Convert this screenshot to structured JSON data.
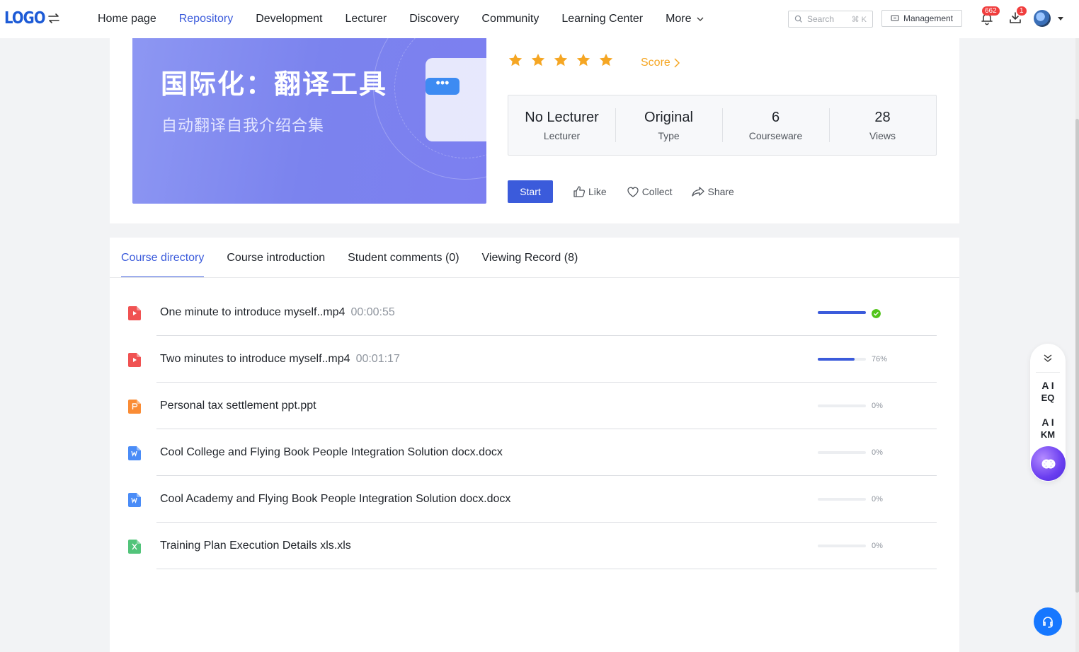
{
  "nav": {
    "logo": "LOGO",
    "items": [
      {
        "label": "Home page",
        "active": false
      },
      {
        "label": "Repository",
        "active": true
      },
      {
        "label": "Development",
        "active": false
      },
      {
        "label": "Lecturer",
        "active": false
      },
      {
        "label": "Discovery",
        "active": false
      },
      {
        "label": "Community",
        "active": false
      },
      {
        "label": "Learning Center",
        "active": false
      }
    ],
    "more_label": "More",
    "search_placeholder": "Search",
    "search_shortcut": "⌘ K",
    "management_label": "Management",
    "notification_count": "662",
    "download_count": "1"
  },
  "course": {
    "cover_title": "国际化：翻译工具",
    "cover_subtitle": "自动翻译自我介绍合集",
    "rating": 5,
    "score_label": "Score",
    "stats": [
      {
        "value": "No Lecturer",
        "label": "Lecturer"
      },
      {
        "value": "Original",
        "label": "Type"
      },
      {
        "value": "6",
        "label": "Courseware"
      },
      {
        "value": "28",
        "label": "Views"
      }
    ],
    "actions": {
      "start": "Start",
      "like": "Like",
      "collect": "Collect",
      "share": "Share"
    }
  },
  "tabs": [
    {
      "label": "Course directory",
      "active": true
    },
    {
      "label": "Course introduction",
      "active": false
    },
    {
      "label": "Student comments (0)",
      "active": false
    },
    {
      "label": "Viewing Record (8)",
      "active": false
    }
  ],
  "files": [
    {
      "name": "One minute to introduce myself..mp4",
      "duration": "00:00:55",
      "type": "video",
      "progress": 1.0,
      "progress_text": "",
      "completed": true
    },
    {
      "name": "Two minutes to introduce myself..mp4",
      "duration": "00:01:17",
      "type": "video",
      "progress": 0.76,
      "progress_text": "76%",
      "completed": false
    },
    {
      "name": "Personal tax settlement ppt.ppt",
      "duration": "",
      "type": "ppt",
      "progress": 0,
      "progress_text": "0%",
      "completed": false
    },
    {
      "name": "Cool College and Flying Book People Integration Solution docx.docx",
      "duration": "",
      "type": "doc",
      "progress": 0,
      "progress_text": "0%",
      "completed": false
    },
    {
      "name": "Cool Academy and Flying Book People Integration Solution docx.docx",
      "duration": "",
      "type": "doc",
      "progress": 0,
      "progress_text": "0%",
      "completed": false
    },
    {
      "name": "Training Plan Execution Details xls.xls",
      "duration": "",
      "type": "xls",
      "progress": 0,
      "progress_text": "0%",
      "completed": false
    }
  ],
  "float_panel": {
    "ai_eq_top": "A I",
    "ai_eq_bottom": "EQ",
    "ai_km_top": "A I",
    "ai_km_bottom": "KM"
  },
  "colors": {
    "accent": "#3b5bdb",
    "star": "#f5a623",
    "video": "#f05252",
    "ppt": "#fa8c35",
    "doc": "#4a8cf7",
    "xls": "#52c47a",
    "success": "#52c41a"
  }
}
